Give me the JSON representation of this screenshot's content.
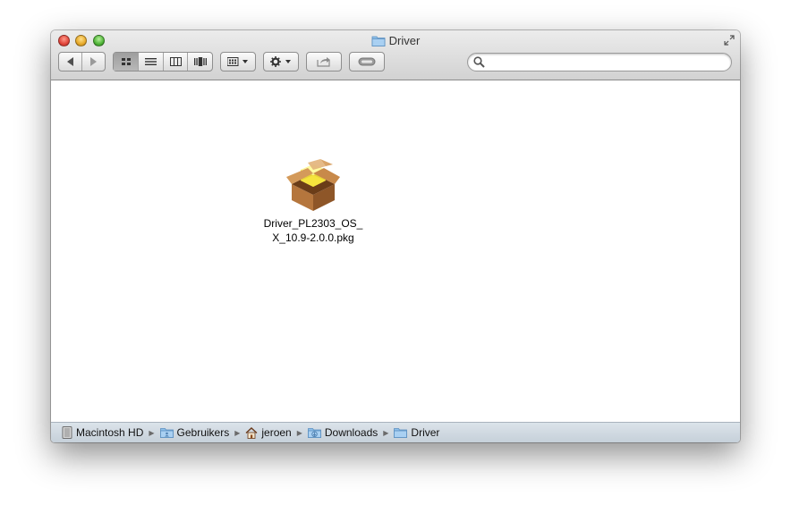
{
  "window": {
    "title": "Driver"
  },
  "toolbar": {
    "view_segments": [
      "icon-view",
      "list-view",
      "column-view",
      "cover-flow-view"
    ],
    "active_view": "icon-view",
    "search_placeholder": ""
  },
  "files": [
    {
      "name": "Driver_PL2303_OS_X_10.9-2.0.0.pkg",
      "icon": "installer-package-icon"
    }
  ],
  "pathbar": {
    "items": [
      {
        "label": "Macintosh HD",
        "icon": "hard-drive-icon"
      },
      {
        "label": "Gebruikers",
        "icon": "folder-users-icon"
      },
      {
        "label": "jeroen",
        "icon": "home-icon"
      },
      {
        "label": "Downloads",
        "icon": "downloads-folder-icon"
      },
      {
        "label": "Driver",
        "icon": "folder-icon"
      }
    ]
  },
  "colors": {
    "folder_blue": "#7fb0e0",
    "pathbar_bg": "#cfd8e0",
    "close": "#e0443a",
    "minimize": "#e6a92a",
    "zoom": "#4fb438"
  }
}
